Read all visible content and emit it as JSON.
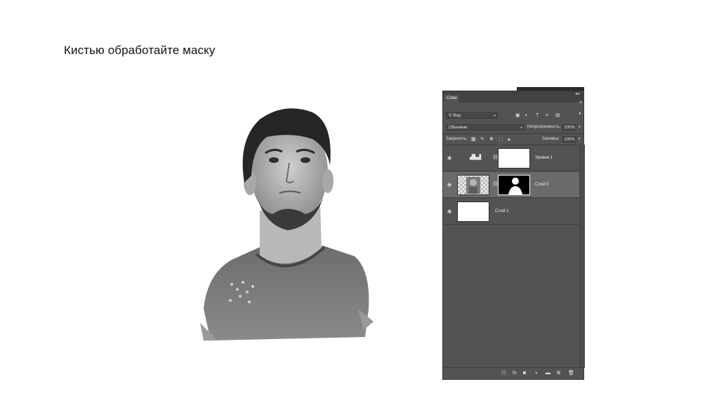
{
  "slide": {
    "title": "Кистью обработайте маску"
  },
  "panel": {
    "tab_label": "Слои",
    "filter_kind": "Вид",
    "blend_mode": "Обычные",
    "opacity_label": "Непрозрачность:",
    "opacity_value": "100%",
    "lock_label": "Закрепить:",
    "fill_label": "Заливка:",
    "fill_value": "100%",
    "layers": [
      {
        "name": "Уровни 1",
        "type": "adjustment",
        "selected": false
      },
      {
        "name": "Слой 0",
        "type": "pixel-with-mask",
        "selected": true
      },
      {
        "name": "Слой 1",
        "type": "pixel",
        "selected": false
      }
    ],
    "filter_icons": [
      "image-filter-icon",
      "adjustment-filter-icon",
      "type-filter-icon",
      "shape-filter-icon",
      "smartobject-filter-icon"
    ],
    "lock_icons": [
      "lock-transparent-icon",
      "lock-image-icon",
      "lock-position-icon",
      "lock-artboard-icon",
      "lock-all-icon"
    ],
    "footer_icons": [
      "link-layers-icon",
      "fx-icon",
      "add-mask-icon",
      "new-adjustment-icon",
      "new-group-icon",
      "new-layer-icon",
      "delete-layer-icon"
    ]
  },
  "colors": {
    "panel_bg": "#535353",
    "panel_dark": "#424242",
    "selected_layer": "#6a6a6a"
  }
}
